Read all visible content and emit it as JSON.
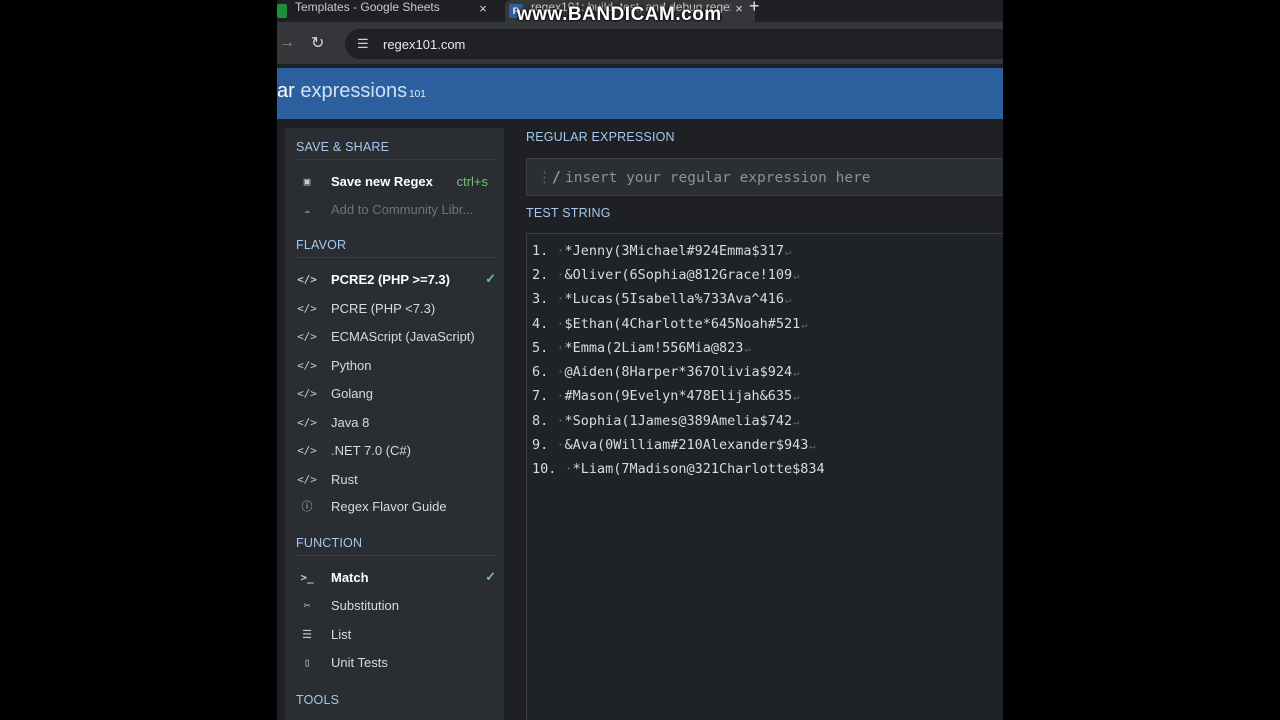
{
  "browser": {
    "tabs": [
      {
        "title": "Templates - Google Sheets",
        "close": "×"
      },
      {
        "title": "regex101: build, test, and debug regex",
        "close": "×"
      }
    ],
    "new_tab": "+",
    "watermark": "www.BANDICAM.com",
    "url": "regex101.com"
  },
  "header": {
    "logo_part1": "ar",
    "logo_part2": " expressions",
    "logo_part3": "101"
  },
  "sidebar": {
    "save_share": {
      "title": "SAVE & SHARE",
      "save_label": "Save new Regex",
      "save_shortcut": "ctrl+s",
      "community_label": "Add to Community Libr..."
    },
    "flavor": {
      "title": "FLAVOR",
      "items": [
        "PCRE2 (PHP >=7.3)",
        "PCRE (PHP <7.3)",
        "ECMAScript (JavaScript)",
        "Python",
        "Golang",
        "Java 8",
        ".NET 7.0 (C#)",
        "Rust",
        "Regex Flavor Guide"
      ]
    },
    "function": {
      "title": "FUNCTION",
      "items": [
        "Match",
        "Substitution",
        "List",
        "Unit Tests"
      ]
    },
    "tools": {
      "title": "TOOLS"
    }
  },
  "main": {
    "regex_title": "REGULAR EXPRESSION",
    "regex_delimiter": "/",
    "regex_placeholder": "insert your regular expression here",
    "test_title": "TEST STRING",
    "test_lines": [
      "*Jenny(3Michael#924Emma$317",
      "&Oliver(6Sophia@812Grace!109",
      "*Lucas(5Isabella%733Ava^416",
      "$Ethan(4Charlotte*645Noah#521",
      "*Emma(2Liam!556Mia@823",
      "@Aiden(8Harper*367Olivia$924",
      "#Mason(9Evelyn*478Elijah&635",
      "*Sophia(1James@389Amelia$742",
      "&Ava(0William#210Alexander$943",
      "*Liam(7Madison@321Charlotte$834"
    ]
  },
  "colors": {
    "header_blue": "#2c5f9e",
    "section_title": "#a6c8f0",
    "check_green": "#6cc47a"
  }
}
